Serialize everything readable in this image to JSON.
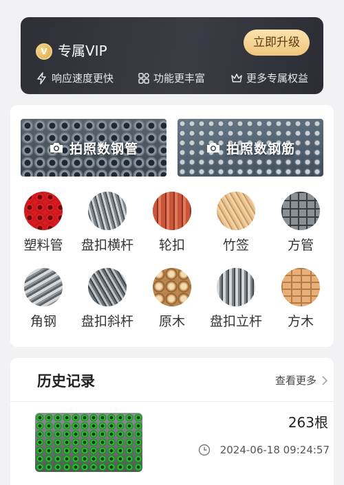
{
  "vip": {
    "badge": "V",
    "title": "专属VIP",
    "upgrade_label": "立即升级",
    "features": [
      {
        "icon": "lightning-icon",
        "label": "响应速度更快"
      },
      {
        "icon": "grid-icon",
        "label": "功能更丰富"
      },
      {
        "icon": "crown-icon",
        "label": "更多专属权益"
      }
    ]
  },
  "banners": [
    {
      "icon": "camera-icon",
      "label": "拍照数钢管"
    },
    {
      "icon": "camera-icon",
      "label": "拍照数钢筋"
    }
  ],
  "categories": [
    {
      "label": "塑料管",
      "icon": "plastic-pipe-icon"
    },
    {
      "label": "盘扣横杆",
      "icon": "ringlock-ledger-icon"
    },
    {
      "label": "轮扣",
      "icon": "wheel-buckle-icon"
    },
    {
      "label": "竹签",
      "icon": "bamboo-stick-icon"
    },
    {
      "label": "方管",
      "icon": "square-tube-icon"
    },
    {
      "label": "角钢",
      "icon": "angle-steel-icon"
    },
    {
      "label": "盘扣斜杆",
      "icon": "ringlock-diagonal-icon"
    },
    {
      "label": "原木",
      "icon": "log-icon"
    },
    {
      "label": "盘扣立杆",
      "icon": "ringlock-standard-icon"
    },
    {
      "label": "方木",
      "icon": "timber-icon"
    }
  ],
  "history": {
    "title": "历史记录",
    "more_label": "查看更多",
    "records": [
      {
        "count": "263根",
        "time": "2024-06-18 09:24:57"
      }
    ]
  },
  "colors": {
    "vip_bg": "#33343c",
    "vip_button": "#f4cf86",
    "page_bg": "#f2f2f4"
  }
}
